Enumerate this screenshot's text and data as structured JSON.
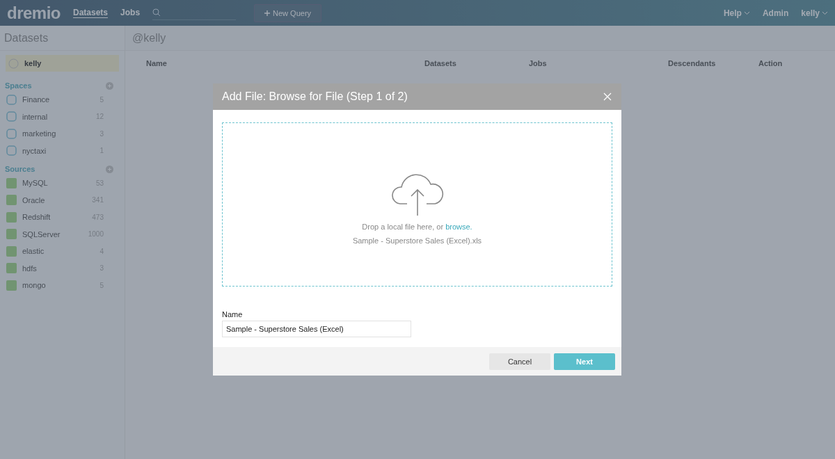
{
  "topbar": {
    "logo": "dremio",
    "nav": [
      {
        "label": "Datasets",
        "selected": true
      },
      {
        "label": "Jobs",
        "selected": false
      }
    ],
    "new_query": "New Query",
    "menus": [
      {
        "label": "Help",
        "dropdown": true
      },
      {
        "label": "Admin",
        "dropdown": false
      },
      {
        "label": "kelly",
        "dropdown": true
      }
    ]
  },
  "sidebar": {
    "title": "Datasets",
    "home": {
      "label": "kelly",
      "selected": true
    },
    "sections": [
      {
        "title": "Spaces",
        "kind": "space",
        "items": [
          {
            "name": "Finance",
            "count": "5"
          },
          {
            "name": "internal",
            "count": "12"
          },
          {
            "name": "marketing",
            "count": "3"
          },
          {
            "name": "nyctaxi",
            "count": "1"
          }
        ]
      },
      {
        "title": "Sources",
        "kind": "source",
        "items": [
          {
            "name": "MySQL",
            "count": "53"
          },
          {
            "name": "Oracle",
            "count": "341"
          },
          {
            "name": "Redshift",
            "count": "473"
          },
          {
            "name": "SQLServer",
            "count": "1000"
          },
          {
            "name": "elastic",
            "count": "4"
          },
          {
            "name": "hdfs",
            "count": "3"
          },
          {
            "name": "mongo",
            "count": "5"
          }
        ]
      }
    ]
  },
  "main": {
    "title": "@kelly",
    "columns": [
      "Name",
      "Datasets",
      "Jobs",
      "Descendants",
      "Action"
    ]
  },
  "dialog": {
    "title": "Add File: Browse for File (Step 1 of 2)",
    "drop_text": "Drop a local file here, or",
    "browse_link": "browse.",
    "file_name": "Sample - Superstore Sales (Excel).xls",
    "name_label": "Name",
    "name_value": "Sample - Superstore Sales (Excel)",
    "buttons": [
      {
        "label": "Cancel",
        "kind": "secondary"
      },
      {
        "label": "Next",
        "kind": "primary"
      }
    ]
  }
}
